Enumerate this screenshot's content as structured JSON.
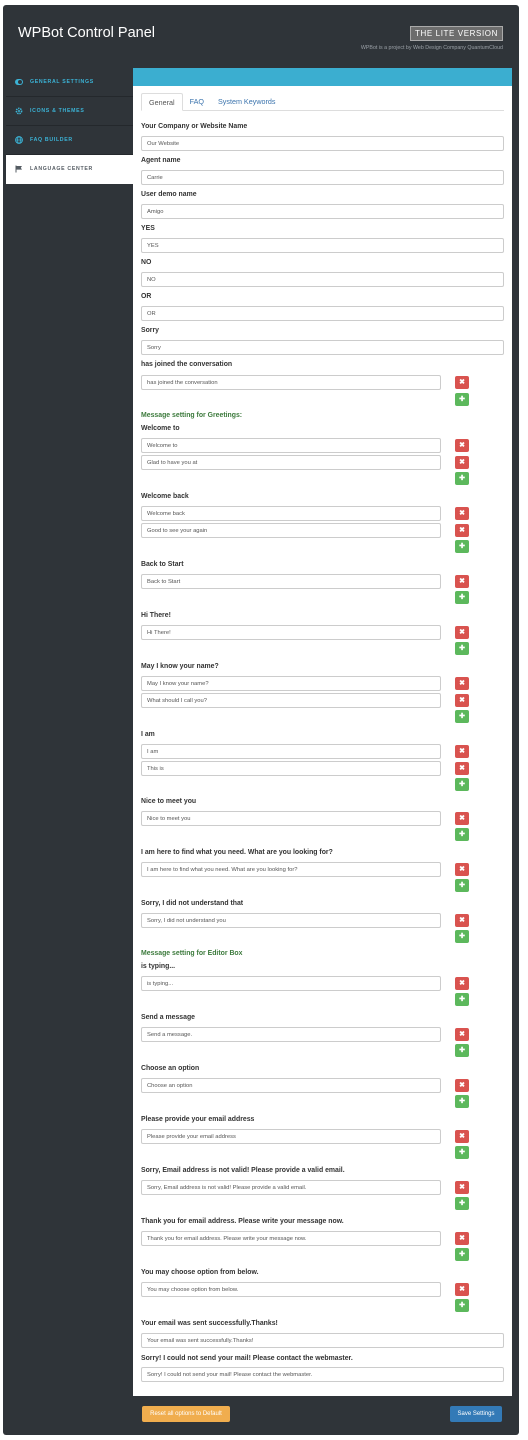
{
  "header": {
    "title": "WPBot Control Panel",
    "badge": "THE LITE VERSION",
    "subtitle": "WPBot is a project by Web Design Company QuantumCloud"
  },
  "sidebar": {
    "items": [
      {
        "label": "GENERAL SETTINGS",
        "icon": "toggle-icon"
      },
      {
        "label": "ICONS & THEMES",
        "icon": "gear-icon"
      },
      {
        "label": "FAQ BUILDER",
        "icon": "globe-icon"
      },
      {
        "label": "LANGUAGE CENTER",
        "icon": "flag-icon",
        "active": true
      }
    ]
  },
  "tabs": [
    "General",
    "FAQ",
    "System Keywords"
  ],
  "fields": {
    "company_label": "Your Company or Website Name",
    "company_value": "Our Website",
    "agent_label": "Agent name",
    "agent_value": "Carrie",
    "user_demo_label": "User demo name",
    "user_demo_value": "Amigo",
    "yes_label": "YES",
    "yes_value": "YES",
    "no_label": "NO",
    "no_value": "NO",
    "or_label": "OR",
    "or_value": "OR",
    "sorry_label": "Sorry",
    "sorry_value": "Sorry",
    "joined_label": "has joined the conversation",
    "joined_value": "has joined the conversation",
    "greetings_heading": "Message setting for Greetings:",
    "welcome_label": "Welcome to",
    "welcome_value_1": "Welcome to",
    "welcome_value_2": "Glad to have you at",
    "welcome_back_label": "Welcome back",
    "welcome_back_value_1": "Welcome back",
    "welcome_back_value_2": "Good to see your again",
    "back_start_label": "Back to Start",
    "back_start_value": "Back to Start",
    "hi_label": "Hi There!",
    "hi_value": "Hi There!",
    "name_label": "May I know your name?",
    "name_value_1": "May I know your name?",
    "name_value_2": "What should I call you?",
    "i_am_label": "I am",
    "i_am_value_1": "I am",
    "i_am_value_2": "This is",
    "nice_label": "Nice to meet you",
    "nice_value": "Nice to meet you",
    "find_label": "I am here to find what you need. What are you looking for?",
    "find_value": "I am here to find what you need. What are you looking for?",
    "not_understand_label": "Sorry, I did not understand that",
    "not_understand_value": "Sorry, I did not understand you",
    "editor_heading": "Message setting for Editor Box",
    "typing_label": "is typing...",
    "typing_value": "is typing...",
    "send_label": "Send a message",
    "send_value": "Send a message.",
    "choose_label": "Choose an option",
    "choose_value": "Choose an option",
    "email_label": "Please provide your email address",
    "email_value": "Please provide your email address",
    "invalid_label": "Sorry, Email address is not valid! Please provide a valid email.",
    "invalid_value": "Sorry, Email address is not valid! Please provide a valid email.",
    "thanks_label": "Thank you for email address. Please write your message now.",
    "thanks_value": "Thank you for email address. Please write your message now.",
    "may_choose_label": "You may choose option from below.",
    "may_choose_value": "You may choose option from below.",
    "sent_label": "Your email was sent successfully.Thanks!",
    "sent_value": "Your email was sent successfully.Thanks!",
    "fail_label": "Sorry! I could not send your mail! Please contact the webmaster.",
    "fail_value": "Sorry! I could not send your mail! Please contact the webmaster."
  },
  "buttons": {
    "remove_symbol": "✖",
    "add_symbol": "✚",
    "reset": "Reset all options to Default",
    "save": "Save Settings"
  },
  "colors": {
    "panel": "#2f3439",
    "accent": "#3baed0",
    "danger": "#d9534f",
    "success": "#5cb85c",
    "warning": "#f0ad4e",
    "primary": "#337ab7"
  }
}
